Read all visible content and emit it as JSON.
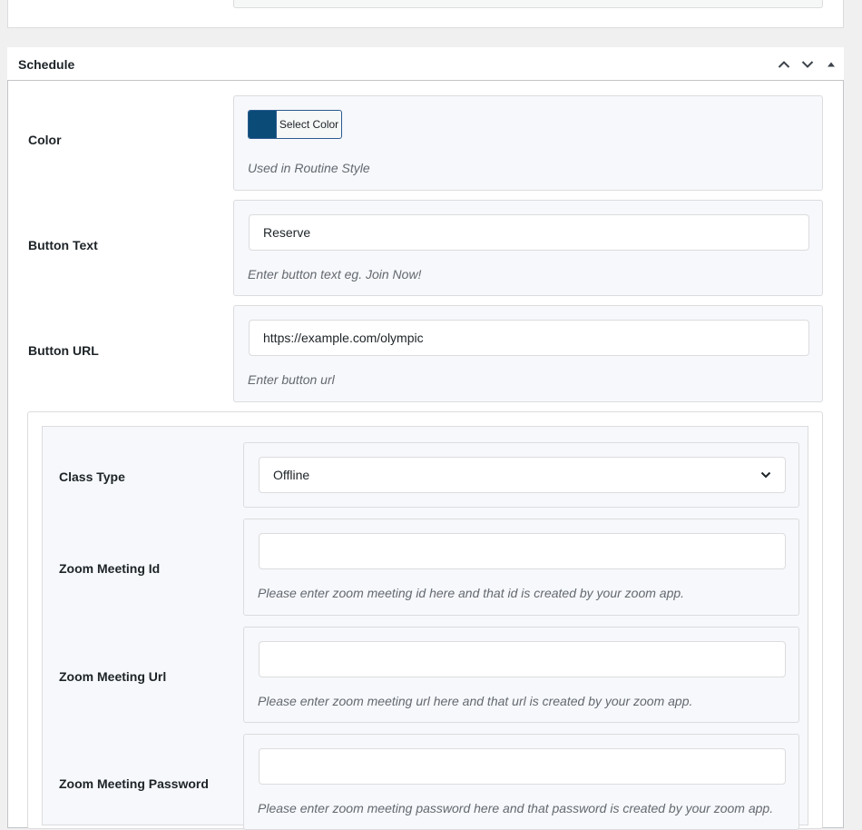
{
  "metabox": {
    "title": "Schedule",
    "controls": [
      "chevron-up-icon",
      "chevron-down-icon",
      "triangle-up-icon"
    ]
  },
  "fields": {
    "color": {
      "label": "Color",
      "button_label": "Select Color",
      "swatch_color": "#0a4b78",
      "description": "Used in Routine Style"
    },
    "button_text": {
      "label": "Button Text",
      "value": "Reserve",
      "description": "Enter button text eg. Join Now!"
    },
    "button_url": {
      "label": "Button URL",
      "value": "https://example.com/olympic",
      "description": "Enter button url"
    }
  },
  "class_group": {
    "class_type": {
      "label": "Class Type",
      "selected": "Offline"
    },
    "zoom_meeting_id": {
      "label": "Zoom Meeting Id",
      "value": "",
      "description": "Please enter zoom meeting id here and that id is created by your zoom app."
    },
    "zoom_meeting_url": {
      "label": "Zoom Meeting Url",
      "value": "",
      "description": "Please enter zoom meeting url here and that url is created by your zoom app."
    },
    "zoom_meeting_password": {
      "label": "Zoom Meeting Password",
      "value": "",
      "description": "Please enter zoom meeting password here and that password is created by your zoom app."
    }
  }
}
